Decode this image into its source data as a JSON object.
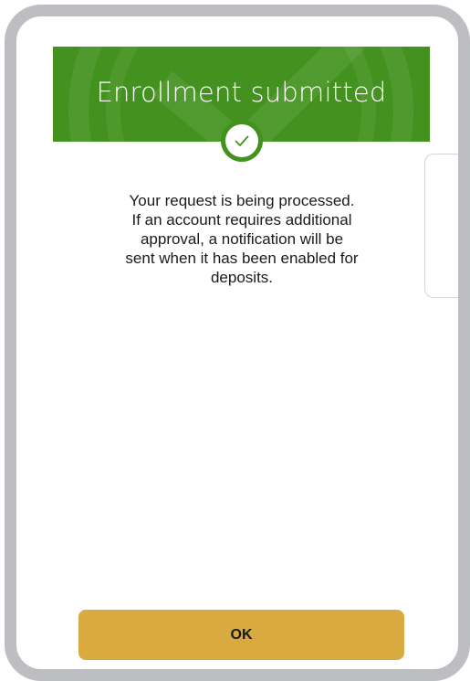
{
  "dialog": {
    "title": "Enrollment submitted",
    "status_icon": "checkmark-circle-icon",
    "message_lines": [
      "Your request is being processed.",
      "If an account requires additional",
      "approval, a notification will be",
      "sent when it has been enabled for",
      "deposits."
    ],
    "ok_label": "OK"
  },
  "colors": {
    "header_green": "#43921f",
    "button_gold": "#d8aa40",
    "frame_gray": "#bdbec2",
    "text": "#1a1a1a"
  }
}
